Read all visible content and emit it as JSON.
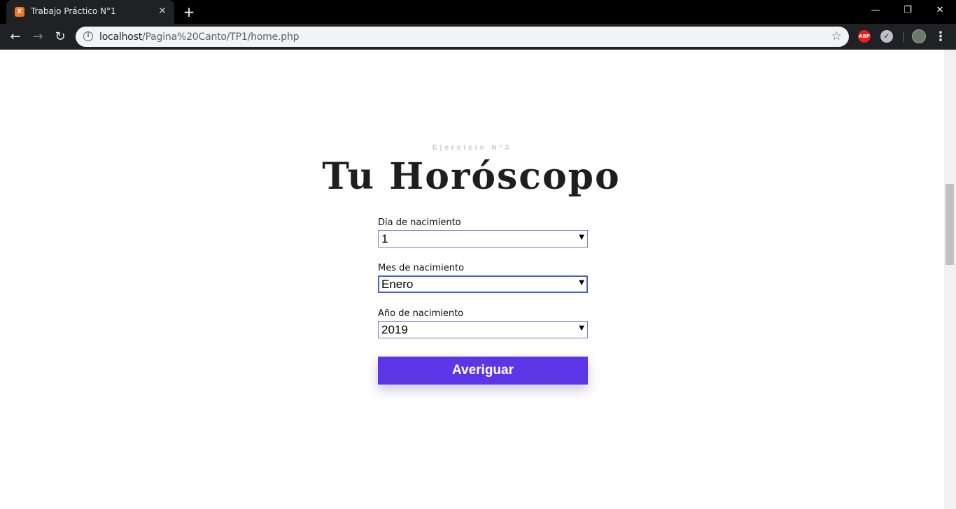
{
  "browser": {
    "tab": {
      "title": "Trabajo Práctico N°1",
      "favicon": "xampp-icon"
    },
    "url": {
      "host": "localhost",
      "path": "/Pagina%20Canto/TP1/home.php"
    },
    "extensions": {
      "abp_label": "ABP"
    }
  },
  "page": {
    "subtitle": "Ejercicio N°3",
    "title": "Tu Horóscopo",
    "fields": [
      {
        "label": "Dia de nacimiento",
        "value": "1"
      },
      {
        "label": "Mes de nacimiento",
        "value": "Enero"
      },
      {
        "label": "Año de nacimiento",
        "value": "2019"
      }
    ],
    "submit_label": "Averiguar"
  },
  "colors": {
    "accent": "#5b35e6",
    "select_border": "#7a7ad8",
    "title_text": "#1e1e1e",
    "subtitle_text": "#c9c9c9"
  }
}
